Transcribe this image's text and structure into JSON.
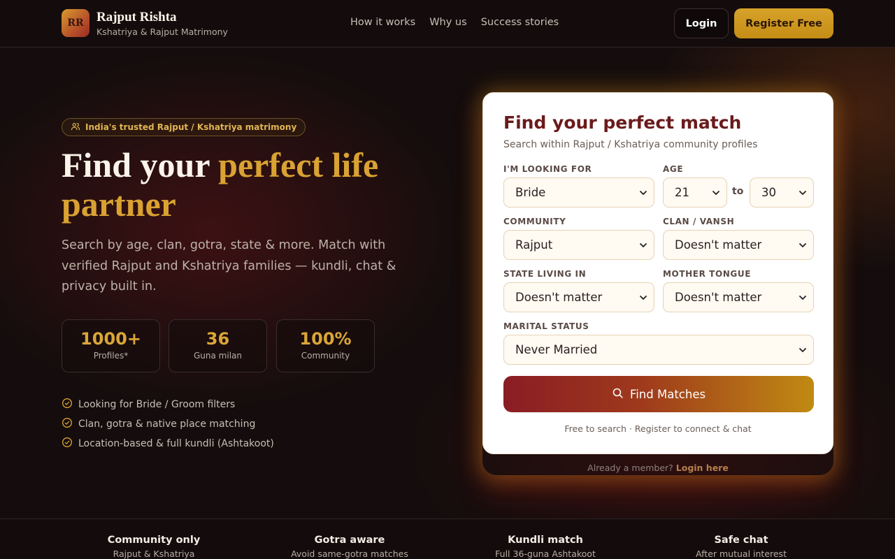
{
  "brand": {
    "logo_text": "RR",
    "name": "Rajput Rishta",
    "tagline": "Kshatriya & Rajput Matrimony"
  },
  "nav": [
    "How it works",
    "Why us",
    "Success stories"
  ],
  "header_actions": {
    "login": "Login",
    "register": "Register Free"
  },
  "hero": {
    "badge": "India's trusted Rajput / Kshatriya matrimony",
    "title_plain": "Find your ",
    "title_accent": "perfect life partner",
    "subtitle": "Search by age, clan, gotra, state & more. Match with verified Rajput and Kshatriya families — kundli, chat & privacy built in.",
    "stats": [
      {
        "value": "1000+",
        "label": "Profiles*"
      },
      {
        "value": "36",
        "label": "Guna milan"
      },
      {
        "value": "100%",
        "label": "Community"
      }
    ],
    "features": [
      "Looking for Bride / Groom filters",
      "Clan, gotra & native place matching",
      "Location-based & full kundli (Ashtakoot)"
    ]
  },
  "search": {
    "title": "Find your perfect match",
    "subtitle": "Search within Rajput / Kshatriya community profiles",
    "looking_for": {
      "label": "I'M LOOKING FOR",
      "value": "Bride"
    },
    "age": {
      "label": "AGE",
      "from": "21",
      "to_label": "to",
      "to": "30"
    },
    "community": {
      "label": "COMMUNITY",
      "value": "Rajput"
    },
    "clan": {
      "label": "CLAN / VANSH",
      "value": "Doesn't matter"
    },
    "state": {
      "label": "STATE LIVING IN",
      "value": "Doesn't matter"
    },
    "mother_tongue": {
      "label": "MOTHER TONGUE",
      "value": "Doesn't matter"
    },
    "marital_status": {
      "label": "MARITAL STATUS",
      "value": "Never Married"
    },
    "button": "Find Matches",
    "note": "Free to search · Register to connect & chat",
    "member_prefix": "Already a member? ",
    "member_link": "Login here"
  },
  "strip": [
    {
      "title": "Community only",
      "sub": "Rajput & Kshatriya"
    },
    {
      "title": "Gotra aware",
      "sub": "Avoid same-gotra matches"
    },
    {
      "title": "Kundli match",
      "sub": "Full 36-guna Ashtakoot"
    },
    {
      "title": "Safe chat",
      "sub": "After mutual interest"
    }
  ],
  "colors": {
    "background": "#150d0d",
    "accent_gold": "#d9a232",
    "accent_maroon": "#6b1a1c",
    "card": "#ffffff"
  },
  "icons": {
    "badge": "users-icon",
    "feature": "check-circle-icon",
    "search_button": "search-icon",
    "select": "chevron-down-icon"
  }
}
